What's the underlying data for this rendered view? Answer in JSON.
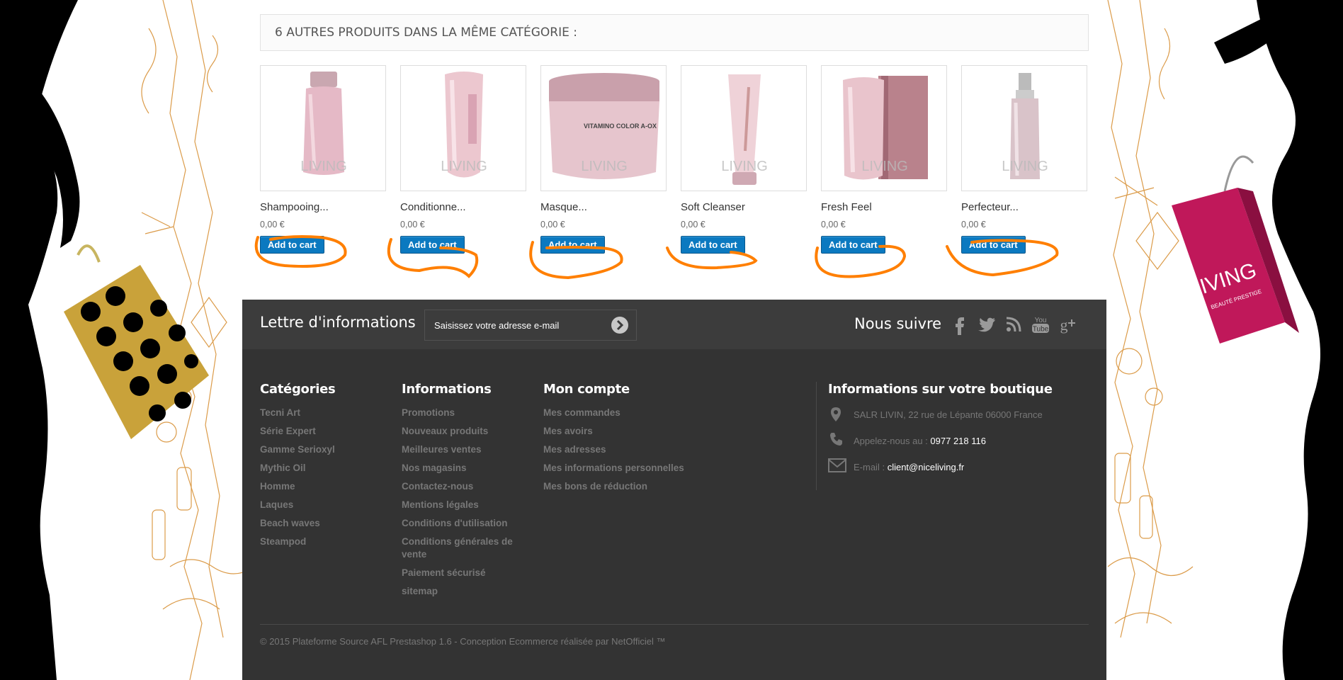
{
  "category_block": {
    "title": "6 autres produits dans la même catégorie :"
  },
  "products": [
    {
      "name": "Shampooing...",
      "price": "0,00 €",
      "button": "Add to cart",
      "watermark": "LIVING"
    },
    {
      "name": "Conditionne...",
      "price": "0,00 €",
      "button": "Add to cart",
      "watermark": "LIVING"
    },
    {
      "name": "Masque...",
      "price": "0,00 €",
      "button": "Add to cart",
      "watermark": "LIVING",
      "label": "VITAMINO COLOR A-OX"
    },
    {
      "name": "Soft Cleanser",
      "price": "0,00 €",
      "button": "Add to cart",
      "watermark": "LIVING"
    },
    {
      "name": "Fresh Feel",
      "price": "0,00 €",
      "button": "Add to cart",
      "watermark": "LIVING"
    },
    {
      "name": "Perfecteur...",
      "price": "0,00 €",
      "button": "Add to cart",
      "watermark": "LIVING"
    }
  ],
  "newsletter": {
    "title": "Lettre d'informations",
    "placeholder": "Saisissez votre adresse e-mail"
  },
  "follow": {
    "title": "Nous suivre",
    "icons": [
      "facebook-icon",
      "twitter-icon",
      "rss-icon",
      "youtube-icon",
      "google-plus-icon"
    ]
  },
  "footer": {
    "categories": {
      "title": "Catégories",
      "items": [
        "Tecni Art",
        "Série Expert",
        "Gamme Serioxyl",
        "Mythic Oil",
        "Homme",
        "Laques",
        "Beach waves",
        "Steampod"
      ]
    },
    "informations": {
      "title": "Informations",
      "items": [
        "Promotions",
        "Nouveaux produits",
        "Meilleures ventes",
        "Nos magasins",
        "Contactez-nous",
        "Mentions légales",
        "Conditions d'utilisation",
        "Conditions générales de vente",
        "Paiement sécurisé",
        "sitemap"
      ]
    },
    "account": {
      "title": "Mon compte",
      "items": [
        "Mes commandes",
        "Mes avoirs",
        "Mes adresses",
        "Mes informations personnelles",
        "Mes bons de réduction"
      ]
    },
    "store": {
      "title": "Informations sur votre boutique",
      "address": "SALR LIVIN, 22 rue de Lépante 06000 France",
      "phone_label": "Appelez-nous au :",
      "phone": "0977 218 116",
      "email_label": "E-mail :",
      "email": "client@niceliving.fr"
    },
    "copyright": "© 2015 Plateforme Source AFL Prestashop 1.6 - Conception Ecommerce réalisée par NetOfficiel ™"
  },
  "decor": {
    "bag_brand": "LIVING",
    "bag_tagline": "BEAUTÉ PRESTIGE"
  },
  "colors": {
    "button_blue": "#0b79c0",
    "footer_bg": "#333333",
    "annotation_orange": "#ff7f00",
    "bag_pink": "#c0185a",
    "bag_gold": "#c9a23a"
  }
}
